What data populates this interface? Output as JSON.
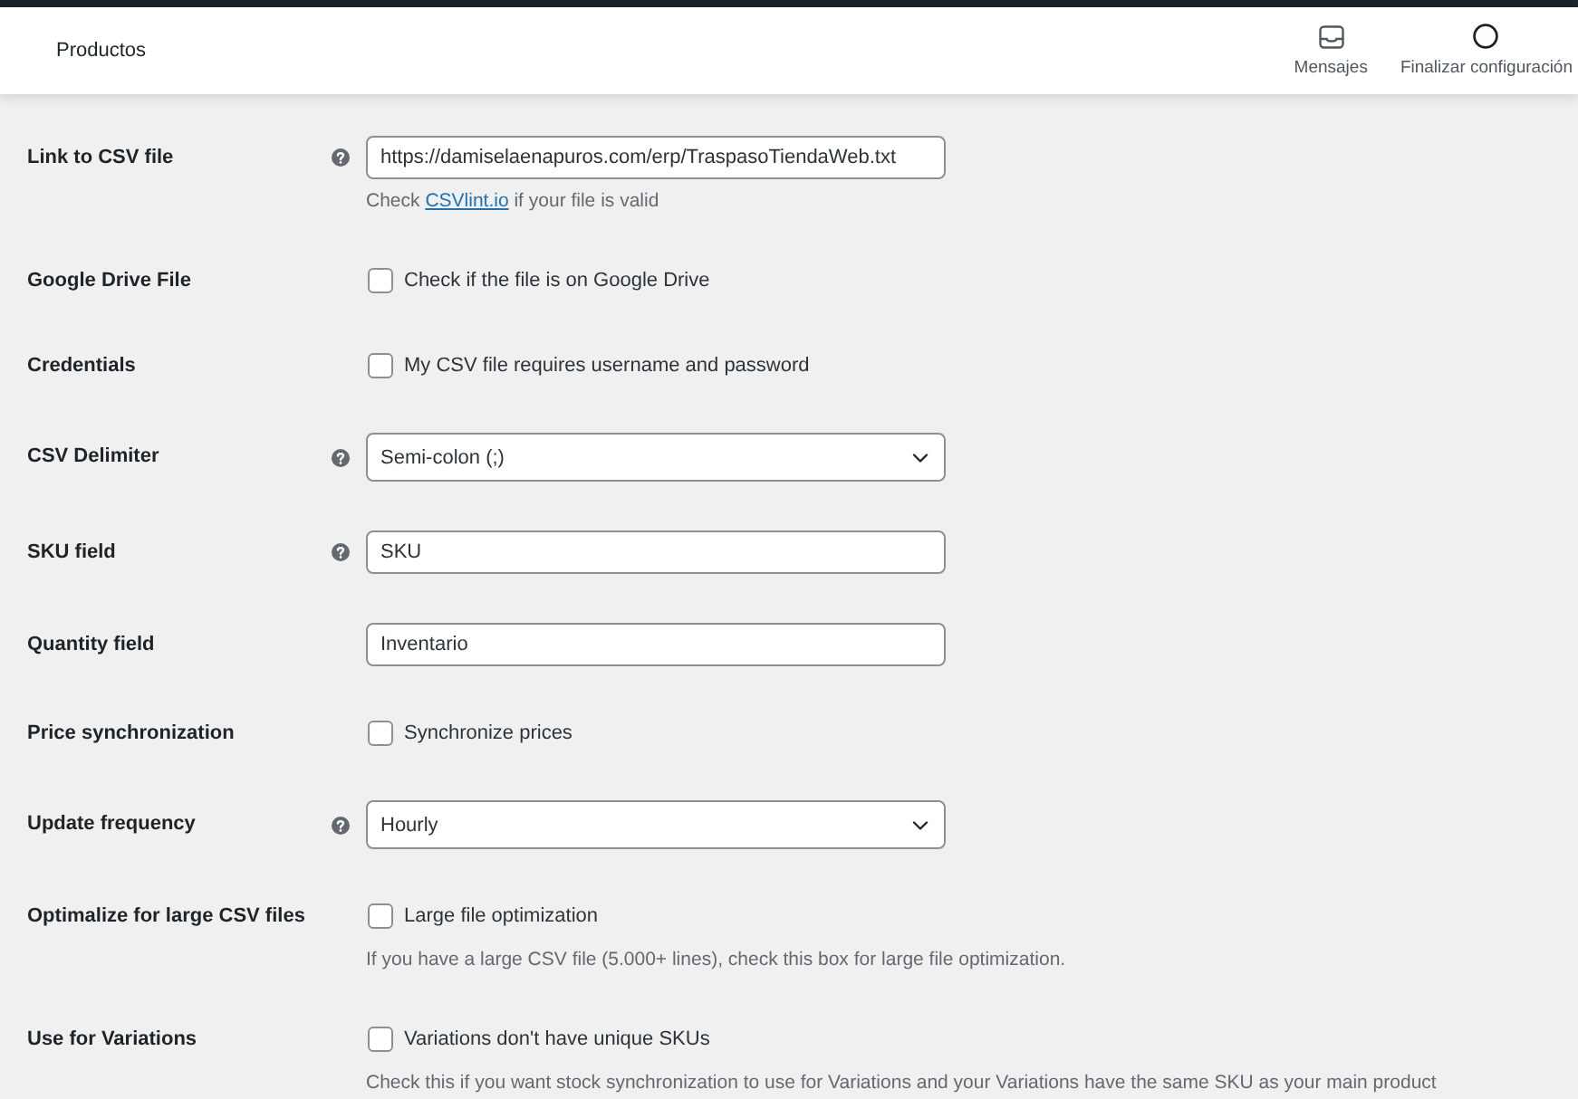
{
  "header": {
    "title": "Productos",
    "actions": [
      {
        "kind": "inbox",
        "label": "Mensajes"
      },
      {
        "kind": "progress",
        "label": "Finalizar configuración"
      }
    ]
  },
  "settings": [
    {
      "label": "Link to CSV file",
      "help": true,
      "kind": "text",
      "value": "https://damiselaenapuros.com/erp/TraspasoTiendaWeb.txt",
      "note": {
        "text_before": "Check",
        "link": "CSVlint.io",
        "text_after": "if your file is valid"
      }
    },
    {
      "label": "Google Drive File",
      "help": false,
      "kind": "checkbox",
      "checked": false,
      "option": "Check if the file is on Google Drive"
    },
    {
      "label": "Credentials",
      "help": false,
      "kind": "checkbox",
      "checked": false,
      "option": "My CSV file requires username and password"
    },
    {
      "label": "CSV Delimiter",
      "help": true,
      "kind": "select",
      "value": "Semi-colon (;)"
    },
    {
      "label": "SKU field",
      "help": true,
      "kind": "text",
      "value": "SKU"
    },
    {
      "label": "Quantity field",
      "help": false,
      "kind": "text",
      "value": "Inventario"
    },
    {
      "label": "Price synchronization",
      "help": false,
      "kind": "checkbox",
      "checked": false,
      "option": "Synchronize prices"
    },
    {
      "label": "Update frequency",
      "help": true,
      "kind": "select",
      "value": "Hourly"
    },
    {
      "label": "Optimalize for large CSV files",
      "help": false,
      "kind": "checkbox",
      "checked": false,
      "option": "Large file optimization",
      "note": {
        "text": "If you have a large CSV file (5.000+ lines), check this box for large file optimization."
      }
    },
    {
      "label": "Use for Variations",
      "help": false,
      "kind": "checkbox",
      "checked": false,
      "option": "Variations don't have unique SKUs",
      "note": {
        "text": "Check this if you want stock synchronization to use for Variations and your Variations have the same SKU as your main product"
      }
    }
  ]
}
